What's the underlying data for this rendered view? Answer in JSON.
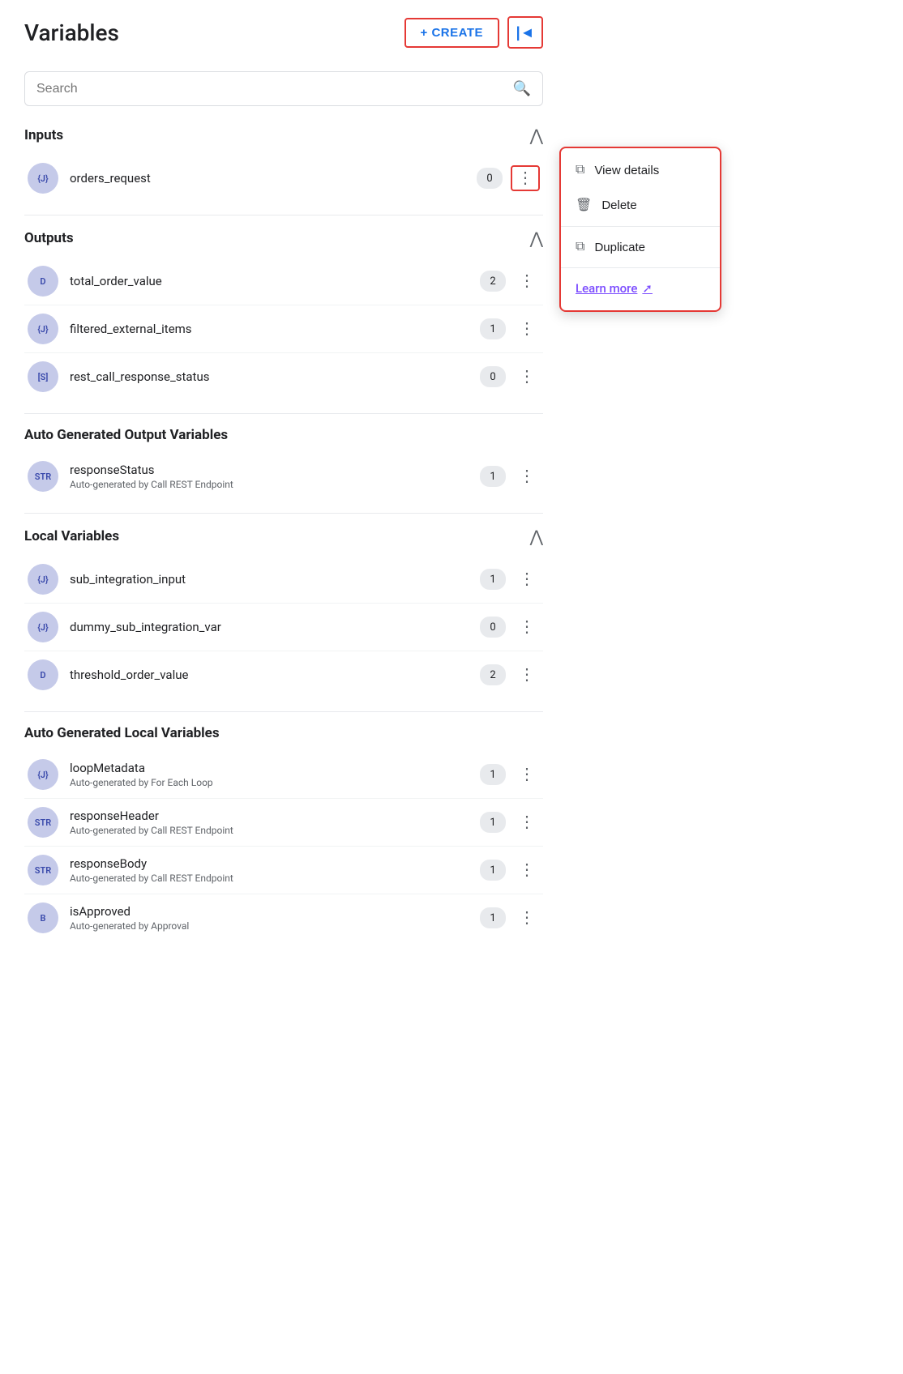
{
  "header": {
    "title": "Variables",
    "create_label": "+ CREATE",
    "collapse_label": "◄"
  },
  "search": {
    "placeholder": "Search"
  },
  "sections": [
    {
      "id": "inputs",
      "title": "Inputs",
      "variables": [
        {
          "id": "orders_request",
          "badge": "{J}",
          "name": "orders_request",
          "count": "0",
          "has_menu": true,
          "subtitle": ""
        }
      ]
    },
    {
      "id": "outputs",
      "title": "Outputs",
      "variables": [
        {
          "id": "total_order_value",
          "badge": "D",
          "name": "total_order_value",
          "count": "2",
          "has_menu": true,
          "subtitle": ""
        },
        {
          "id": "filtered_external_items",
          "badge": "{J}",
          "name": "filtered_external_items",
          "count": "1",
          "has_menu": true,
          "subtitle": ""
        },
        {
          "id": "rest_call_response_status",
          "badge": "[S]",
          "name": "rest_call_response_status",
          "count": "0",
          "has_menu": true,
          "subtitle": ""
        }
      ]
    },
    {
      "id": "auto_output",
      "title": "Auto Generated Output Variables",
      "variables": [
        {
          "id": "responseStatus",
          "badge": "STR",
          "name": "responseStatus",
          "count": "1",
          "has_menu": true,
          "subtitle": "Auto-generated by Call REST Endpoint"
        }
      ]
    },
    {
      "id": "local",
      "title": "Local Variables",
      "variables": [
        {
          "id": "sub_integration_input",
          "badge": "{J}",
          "name": "sub_integration_input",
          "count": "1",
          "has_menu": true,
          "subtitle": ""
        },
        {
          "id": "dummy_sub_integration_var",
          "badge": "{J}",
          "name": "dummy_sub_integration_var",
          "count": "0",
          "has_menu": true,
          "subtitle": ""
        },
        {
          "id": "threshold_order_value",
          "badge": "D",
          "name": "threshold_order_value",
          "count": "2",
          "has_menu": true,
          "subtitle": ""
        }
      ]
    },
    {
      "id": "auto_local",
      "title": "Auto Generated Local Variables",
      "variables": [
        {
          "id": "loopMetadata",
          "badge": "{J}",
          "name": "loopMetadata",
          "count": "1",
          "has_menu": true,
          "subtitle": "Auto-generated by For Each Loop"
        },
        {
          "id": "responseHeader",
          "badge": "STR",
          "name": "responseHeader",
          "count": "1",
          "has_menu": true,
          "subtitle": "Auto-generated by Call REST Endpoint"
        },
        {
          "id": "responseBody",
          "badge": "STR",
          "name": "responseBody",
          "count": "1",
          "has_menu": true,
          "subtitle": "Auto-generated by Call REST Endpoint"
        },
        {
          "id": "isApproved",
          "badge": "B",
          "name": "isApproved",
          "count": "1",
          "has_menu": true,
          "subtitle": "Auto-generated by Approval"
        }
      ]
    }
  ],
  "context_menu": {
    "view_details": "View details",
    "delete": "Delete",
    "duplicate": "Duplicate",
    "learn_more": "Learn more"
  }
}
